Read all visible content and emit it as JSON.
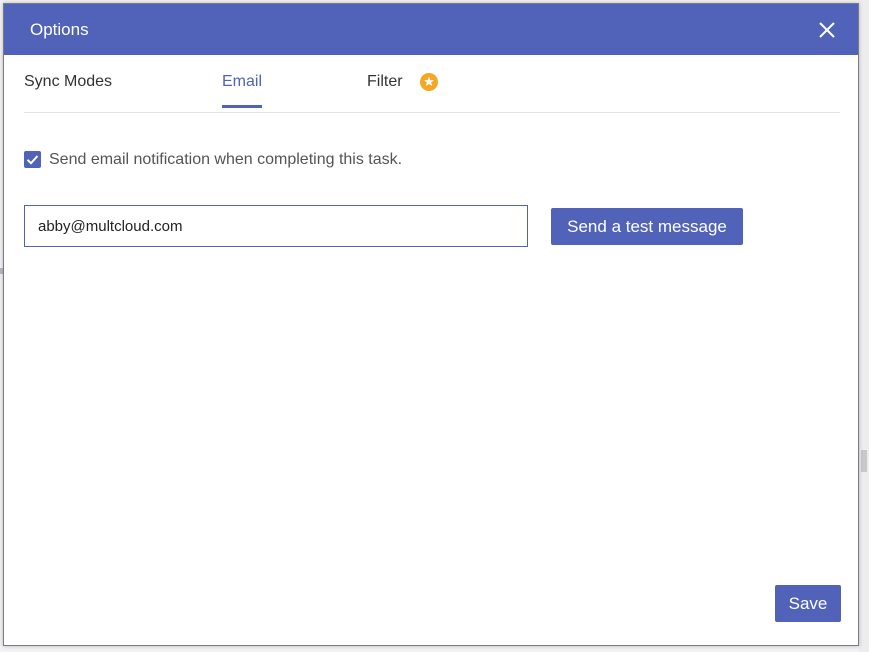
{
  "dialog": {
    "title": "Options",
    "close_icon": "close-icon"
  },
  "tabs": [
    {
      "label": "Sync Modes",
      "active": false
    },
    {
      "label": "Email",
      "active": true
    },
    {
      "label": "Filter",
      "active": false,
      "badge_icon": "premium-star-icon"
    }
  ],
  "email": {
    "notify_checked": true,
    "notify_label": "Send email notification when completing this task.",
    "address_value": "abby@multcloud.com",
    "test_button_label": "Send a test message"
  },
  "footer": {
    "save_label": "Save"
  },
  "colors": {
    "accent": "#5162b9",
    "badge": "#f5a623"
  }
}
